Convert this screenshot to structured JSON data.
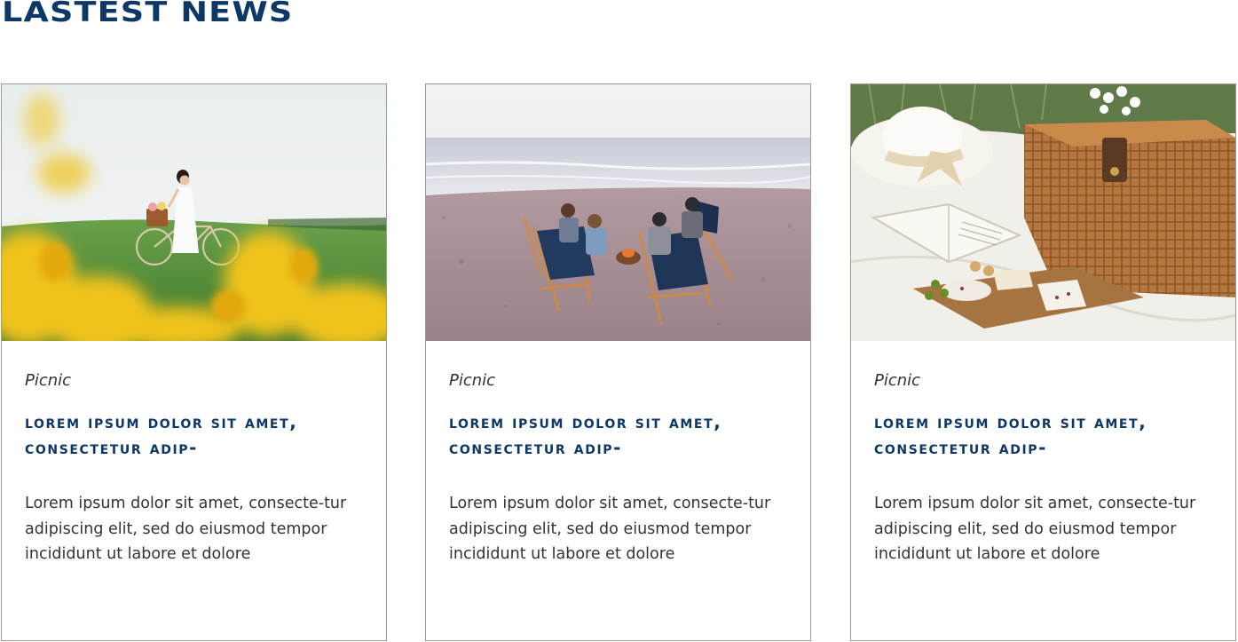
{
  "section": {
    "title": "LASTEST NEWS"
  },
  "cards": [
    {
      "category": "Picnic",
      "title": "Lorem ipsum dolor sit amet, consectetur adip-",
      "excerpt": "Lorem ipsum dolor sit amet, consecte-tur adipiscing elit, sed do eiusmod tempor incididunt ut labore et dolore"
    },
    {
      "category": "Picnic",
      "title": "Lorem ipsum dolor sit amet, consectetur adip-",
      "excerpt": "Lorem ipsum dolor sit amet, consecte-tur adipiscing elit, sed do eiusmod tempor incididunt ut labore et dolore"
    },
    {
      "category": "Picnic",
      "title": "Lorem ipsum dolor sit amet, consectetur adip-",
      "excerpt": "Lorem ipsum dolor sit amet, consecte-tur adipiscing elit, sed do eiusmod tempor incididunt ut labore et dolore"
    }
  ],
  "colors": {
    "heading": "#0d3766",
    "border": "#a8978a",
    "body_text": "#333333"
  }
}
